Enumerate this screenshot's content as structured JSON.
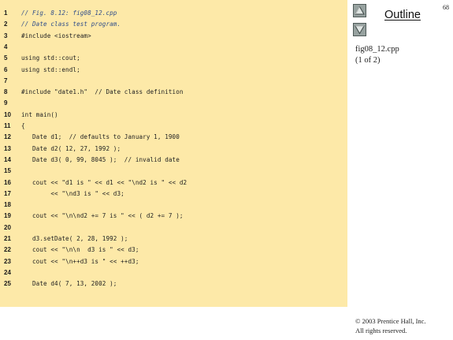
{
  "code": {
    "lines": [
      {
        "num": "1",
        "text": "// Fig. 8.12: fig08_12.cpp"
      },
      {
        "num": "2",
        "text": "// Date class test program."
      },
      {
        "num": "3",
        "text": "#include <iostream>"
      },
      {
        "num": "4",
        "text": ""
      },
      {
        "num": "5",
        "text": "using std::cout;"
      },
      {
        "num": "6",
        "text": "using std::endl;"
      },
      {
        "num": "7",
        "text": ""
      },
      {
        "num": "8",
        "text": "#include \"date1.h\"  // Date class definition"
      },
      {
        "num": "9",
        "text": ""
      },
      {
        "num": "10",
        "text": "int main()"
      },
      {
        "num": "11",
        "text": "{"
      },
      {
        "num": "12",
        "text": "   Date d1;  // defaults to January 1, 1900"
      },
      {
        "num": "13",
        "text": "   Date d2( 12, 27, 1992 );"
      },
      {
        "num": "14",
        "text": "   Date d3( 0, 99, 8045 );  // invalid date"
      },
      {
        "num": "15",
        "text": ""
      },
      {
        "num": "16",
        "text": "   cout << \"d1 is \" << d1 << \"\\nd2 is \" << d2"
      },
      {
        "num": "17",
        "text": "        << \"\\nd3 is \" << d3;"
      },
      {
        "num": "18",
        "text": ""
      },
      {
        "num": "19",
        "text": "   cout << \"\\n\\nd2 += 7 is \" << ( d2 += 7 );"
      },
      {
        "num": "20",
        "text": ""
      },
      {
        "num": "21",
        "text": "   d3.setDate( 2, 28, 1992 );"
      },
      {
        "num": "22",
        "text": "   cout << \"\\n\\n  d3 is \" << d3;"
      },
      {
        "num": "23",
        "text": "   cout << \"\\n++d3 is \" << ++d3;"
      },
      {
        "num": "24",
        "text": ""
      },
      {
        "num": "25",
        "text": "   Date d4( 7, 13, 2002 );"
      }
    ]
  },
  "sidebar": {
    "page_number": "68",
    "outline_label": "Outline",
    "up_icon": "triangle-up-icon",
    "down_icon": "triangle-down-icon",
    "file_name": "fig08_12.cpp",
    "page_of": "(1 of 2)",
    "copyright_line1": "© 2003 Prentice Hall, Inc.",
    "copyright_line2": "All rights reserved."
  },
  "colors": {
    "code_background": "#fde9a8",
    "button_fill": "#97a2a0",
    "comment": "#2f4d8a"
  }
}
